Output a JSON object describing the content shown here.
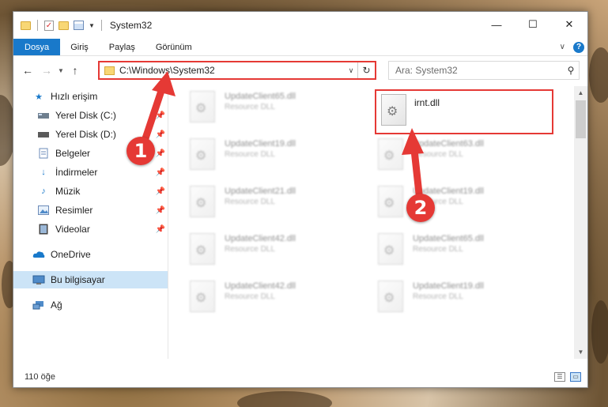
{
  "window": {
    "title": "System32"
  },
  "colors": {
    "accent": "#1979ca",
    "annotation": "#e53935",
    "selected": "#cce4f7"
  },
  "quick_access_icons": [
    "folder-icon",
    "properties-check-icon",
    "folder-icon",
    "properties-icon"
  ],
  "ribbon": {
    "tabs": [
      "Dosya",
      "Giriş",
      "Paylaş",
      "Görünüm"
    ],
    "help_label": "?"
  },
  "address": {
    "path": "C:\\Windows\\System32",
    "search_placeholder": "Ara: System32"
  },
  "sidebar": {
    "items": [
      {
        "label": "Hızlı erişim",
        "icon": "star-icon",
        "pinned": false
      },
      {
        "label": "Yerel Disk (C:)",
        "icon": "drive-icon",
        "pinned": true
      },
      {
        "label": "Yerel Disk (D:)",
        "icon": "drive-icon",
        "pinned": true
      },
      {
        "label": "Belgeler",
        "icon": "documents-icon",
        "pinned": true
      },
      {
        "label": "İndirmeler",
        "icon": "download-icon",
        "pinned": true
      },
      {
        "label": "Müzik",
        "icon": "music-icon",
        "pinned": true
      },
      {
        "label": "Resimler",
        "icon": "pictures-icon",
        "pinned": true
      },
      {
        "label": "Videolar",
        "icon": "video-icon",
        "pinned": true
      },
      {
        "label": "OneDrive",
        "icon": "cloud-icon",
        "pinned": false
      },
      {
        "label": "Bu bilgisayar",
        "icon": "computer-icon",
        "pinned": false,
        "selected": true
      },
      {
        "label": "Ağ",
        "icon": "network-icon",
        "pinned": false
      }
    ]
  },
  "files": {
    "highlighted": {
      "name": "irnt.dll"
    },
    "background": [
      {
        "name": "UpdateClient65.dll",
        "type": "Resource DLL"
      },
      {
        "name": "UpdateClient19.dll",
        "type": "Resource DLL"
      },
      {
        "name": "UpdateClient63.dll",
        "type": "Resource DLL"
      },
      {
        "name": "UpdateClient21.dll",
        "type": "Resource DLL"
      },
      {
        "name": "UpdateClient19.dll",
        "type": "Resource DLL"
      },
      {
        "name": "UpdateClient42.dll",
        "type": "Resource DLL"
      },
      {
        "name": "UpdateClient65.dll",
        "type": "Resource DLL"
      },
      {
        "name": "UpdateClient42.dll",
        "type": "Resource DLL"
      },
      {
        "name": "UpdateClient19.dll",
        "type": "Resource DLL"
      }
    ]
  },
  "status": {
    "count": "110 öğe"
  },
  "annotations": {
    "step1": "1",
    "step2": "2"
  }
}
